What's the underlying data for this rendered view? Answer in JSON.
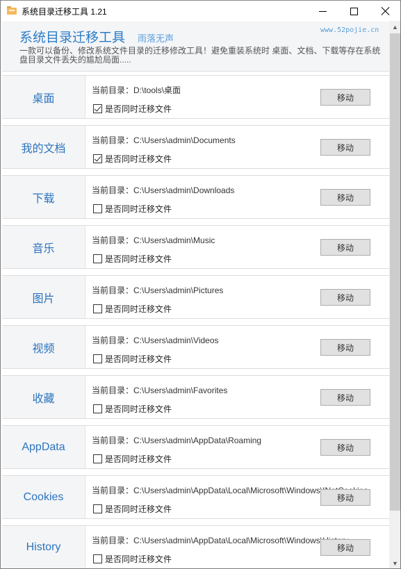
{
  "window": {
    "title": "系统目录迁移工具 1.21",
    "controls": {
      "minimize": "minimize",
      "maximize": "maximize",
      "close": "close"
    }
  },
  "header": {
    "title": "系统目录迁移工具",
    "author": "雨落无声",
    "site": "www.52pojie.cn",
    "description": "一款可以备份、修改系统文件目录的迁移修改工具！避免重装系统时 桌面、文档、下载等存在系统盘目录文件丢失的尴尬局面....."
  },
  "common": {
    "path_prefix": "当前目录：",
    "checkbox_label": "是否同时迁移文件",
    "move_button": "移动"
  },
  "rows": [
    {
      "label": "桌面",
      "path": "D:\\tools\\桌面",
      "migrate_files": true
    },
    {
      "label": "我的文档",
      "path": "C:\\Users\\admin\\Documents",
      "migrate_files": true
    },
    {
      "label": "下载",
      "path": "C:\\Users\\admin\\Downloads",
      "migrate_files": false
    },
    {
      "label": "音乐",
      "path": "C:\\Users\\admin\\Music",
      "migrate_files": false
    },
    {
      "label": "图片",
      "path": "C:\\Users\\admin\\Pictures",
      "migrate_files": false
    },
    {
      "label": "视频",
      "path": "C:\\Users\\admin\\Videos",
      "migrate_files": false
    },
    {
      "label": "收藏",
      "path": "C:\\Users\\admin\\Favorites",
      "migrate_files": false
    },
    {
      "label": "AppData",
      "path": "C:\\Users\\admin\\AppData\\Roaming",
      "migrate_files": false
    },
    {
      "label": "Cookies",
      "path": "C:\\Users\\admin\\AppData\\Local\\Microsoft\\Windows\\INetCookies",
      "migrate_files": false
    },
    {
      "label": "History",
      "path": "C:\\Users\\admin\\AppData\\Local\\Microsoft\\Windows\\History",
      "migrate_files": false
    }
  ],
  "scrollbar": {
    "position_fraction": 0.0,
    "visible_fraction": 0.88
  }
}
